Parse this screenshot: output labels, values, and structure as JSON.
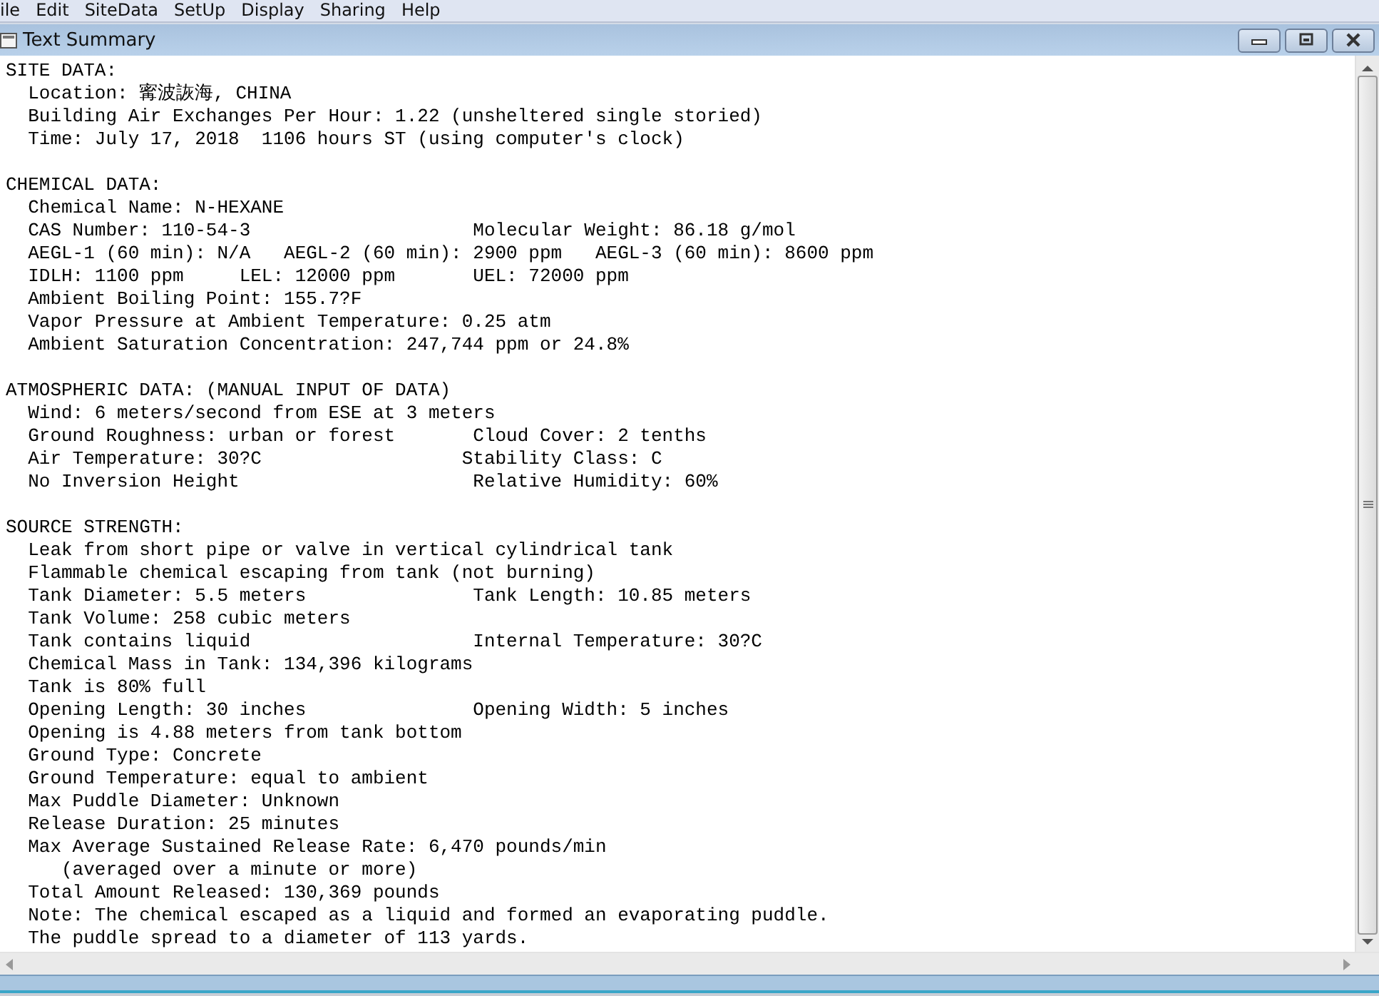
{
  "menu": [
    "ile",
    "Edit",
    "SiteData",
    "SetUp",
    "Display",
    "Sharing",
    "Help"
  ],
  "window": {
    "title": "Text Summary"
  },
  "sections": [
    {
      "heading": "SITE DATA:",
      "lines": [
        "  Location: 寗波詼海, CHINA",
        "  Building Air Exchanges Per Hour: 1.22 (unsheltered single storied)",
        "  Time: July 17, 2018  1106 hours ST (using computer's clock)"
      ]
    },
    {
      "heading": "CHEMICAL DATA:",
      "lines": [
        "  Chemical Name: N-HEXANE",
        "  CAS Number: 110-54-3                    Molecular Weight: 86.18 g/mol",
        "  AEGL-1 (60 min): N/A   AEGL-2 (60 min): 2900 ppm   AEGL-3 (60 min): 8600 ppm",
        "  IDLH: 1100 ppm     LEL: 12000 ppm       UEL: 72000 ppm",
        "  Ambient Boiling Point: 155.7?F",
        "  Vapor Pressure at Ambient Temperature: 0.25 atm",
        "  Ambient Saturation Concentration: 247,744 ppm or 24.8%"
      ]
    },
    {
      "heading": "ATMOSPHERIC DATA: (MANUAL INPUT OF DATA)",
      "lines": [
        "  Wind: 6 meters/second from ESE at 3 meters",
        "  Ground Roughness: urban or forest       Cloud Cover: 2 tenths",
        "  Air Temperature: 30?C                  Stability Class: C",
        "  No Inversion Height                     Relative Humidity: 60%"
      ]
    },
    {
      "heading": "SOURCE STRENGTH:",
      "lines": [
        "  Leak from short pipe or valve in vertical cylindrical tank",
        "  Flammable chemical escaping from tank (not burning)",
        "  Tank Diameter: 5.5 meters               Tank Length: 10.85 meters",
        "  Tank Volume: 258 cubic meters",
        "  Tank contains liquid                    Internal Temperature: 30?C",
        "  Chemical Mass in Tank: 134,396 kilograms",
        "  Tank is 80% full",
        "  Opening Length: 30 inches               Opening Width: 5 inches",
        "  Opening is 4.88 meters from tank bottom",
        "  Ground Type: Concrete",
        "  Ground Temperature: equal to ambient",
        "  Max Puddle Diameter: Unknown",
        "  Release Duration: 25 minutes",
        "  Max Average Sustained Release Rate: 6,470 pounds/min",
        "     (averaged over a minute or more)",
        "  Total Amount Released: 130,369 pounds",
        "  Note: The chemical escaped as a liquid and formed an evaporating puddle.",
        "  The puddle spread to a diameter of 113 yards."
      ]
    }
  ]
}
